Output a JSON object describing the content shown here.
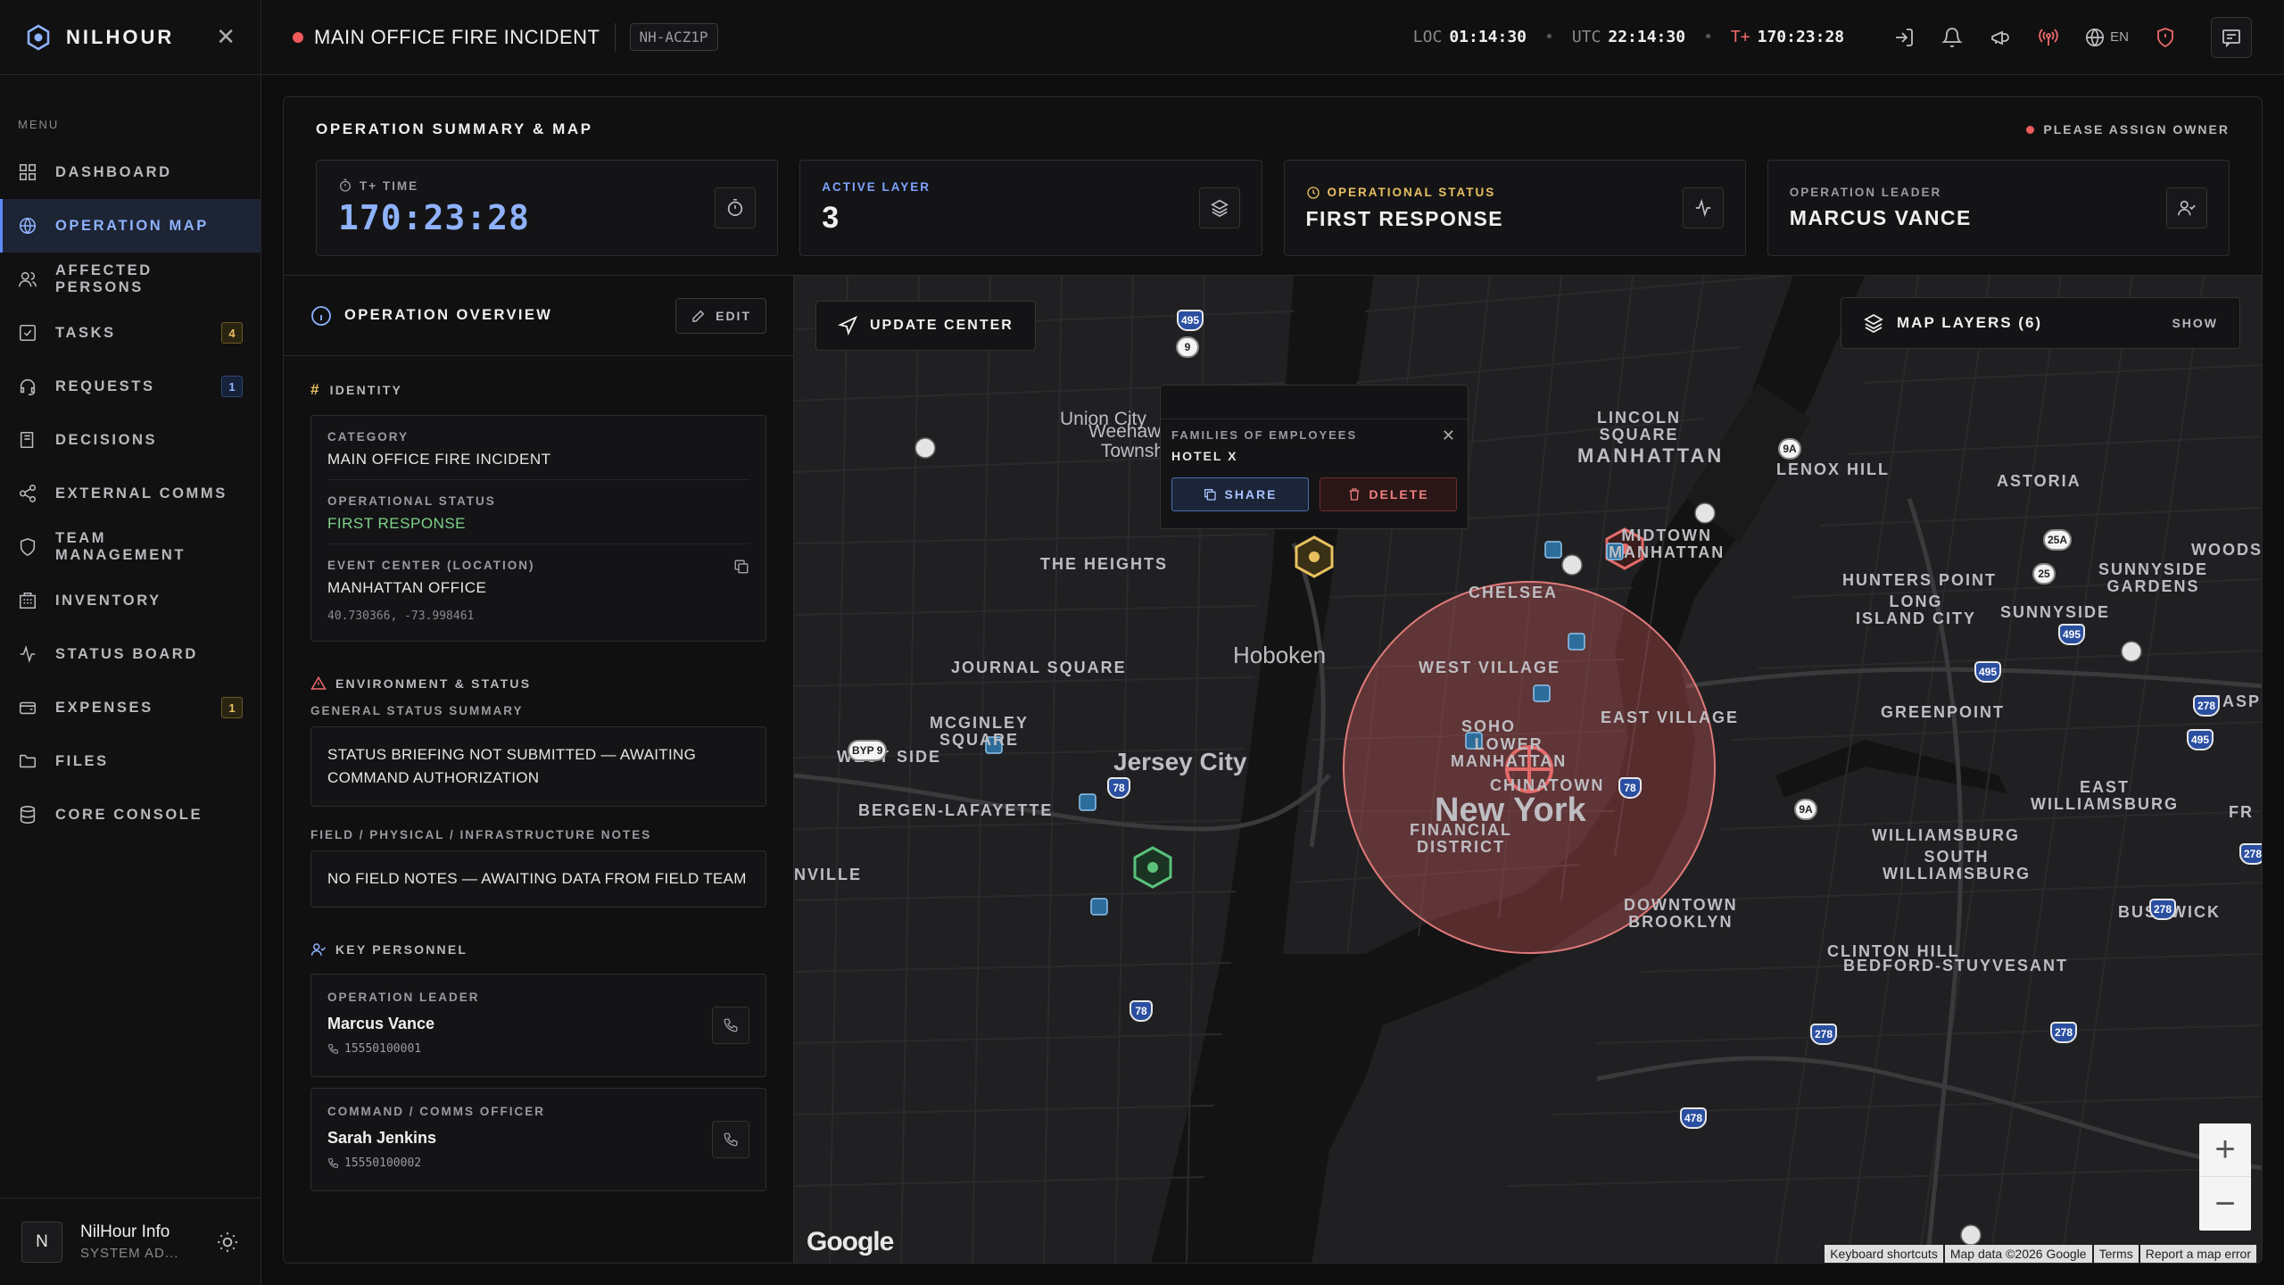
{
  "app": {
    "name": "NILHOUR"
  },
  "sidebar": {
    "menu_label": "MENU",
    "items": [
      {
        "label": "DASHBOARD",
        "icon": "grid-icon"
      },
      {
        "label": "OPERATION MAP",
        "icon": "globe-icon",
        "active": true
      },
      {
        "label": "AFFECTED PERSONS",
        "icon": "users-icon"
      },
      {
        "label": "TASKS",
        "icon": "checkbox-icon",
        "badge": "4"
      },
      {
        "label": "REQUESTS",
        "icon": "headset-icon",
        "badge": "1"
      },
      {
        "label": "DECISIONS",
        "icon": "book-icon"
      },
      {
        "label": "EXTERNAL COMMS",
        "icon": "share-icon"
      },
      {
        "label": "TEAM MANAGEMENT",
        "icon": "shield-icon"
      },
      {
        "label": "INVENTORY",
        "icon": "building-icon"
      },
      {
        "label": "STATUS BOARD",
        "icon": "activity-icon"
      },
      {
        "label": "EXPENSES",
        "icon": "wallet-icon",
        "badge": "1"
      },
      {
        "label": "FILES",
        "icon": "folder-icon"
      },
      {
        "label": "CORE CONSOLE",
        "icon": "database-icon"
      }
    ],
    "user": {
      "initial": "N",
      "name": "NilHour Info",
      "role": "SYSTEM AD..."
    }
  },
  "topbar": {
    "incident_title": "MAIN OFFICE FIRE INCIDENT",
    "incident_code": "NH-ACZ1P",
    "loc_label": "LOC",
    "loc_time": "01:14:30",
    "utc_label": "UTC",
    "utc_time": "22:14:30",
    "tplus_label": "T+",
    "tplus_time": "170:23:28",
    "lang": "EN"
  },
  "summary": {
    "title": "OPERATION SUMMARY & MAP",
    "assign": "PLEASE ASSIGN OWNER",
    "cards": {
      "time_label": "T+ TIME",
      "time_value": "170:23:28",
      "layer_label": "ACTIVE LAYER",
      "layer_value": "3",
      "status_label": "OPERATIONAL STATUS",
      "status_value": "FIRST RESPONSE",
      "leader_label": "OPERATION LEADER",
      "leader_value": "MARCUS VANCE"
    }
  },
  "overview": {
    "title": "OPERATION OVERVIEW",
    "edit": "EDIT",
    "identity_title": "IDENTITY",
    "category_label": "CATEGORY",
    "category_value": "MAIN OFFICE FIRE INCIDENT",
    "opstatus_label": "OPERATIONAL STATUS",
    "opstatus_value": "FIRST RESPONSE",
    "center_label": "EVENT CENTER (LOCATION)",
    "center_value": "MANHATTAN OFFICE",
    "center_coords": "40.730366, -73.998461",
    "env_title": "ENVIRONMENT & STATUS",
    "general_label": "GENERAL STATUS SUMMARY",
    "general_value": "STATUS BRIEFING NOT SUBMITTED — AWAITING COMMAND AUTHORIZATION",
    "field_label": "FIELD / PHYSICAL / INFRASTRUCTURE NOTES",
    "field_value": "NO FIELD NOTES — AWAITING DATA FROM FIELD TEAM",
    "personnel_title": "KEY PERSONNEL",
    "personnel": [
      {
        "role": "OPERATION LEADER",
        "name": "Marcus Vance",
        "phone": "15550100001"
      },
      {
        "role": "COMMAND / COMMS OFFICER",
        "name": "Sarah Jenkins",
        "phone": "15550100002"
      }
    ]
  },
  "map": {
    "update_center": "UPDATE CENTER",
    "layers_label": "MAP LAYERS (6)",
    "layers_show": "SHOW",
    "popup": {
      "label": "FAMILIES OF EMPLOYEES",
      "name": "HOTEL X",
      "share": "SHARE",
      "delete": "DELETE"
    },
    "google": "Google",
    "attribution": [
      "Keyboard shortcuts",
      "Map data ©2026 Google",
      "Terms",
      "Report a map error"
    ],
    "labels": {
      "union_city": "Union City",
      "weehawken": "Weehawken\nTownship",
      "manhattan": "MANHATTAN",
      "lincoln_sq": "LINCOLN\nSQUARE",
      "lenox_hill": "LENOX HILL",
      "astoria": "ASTORIA",
      "midtown": "MIDTOWN\nMANHATTAN",
      "heights": "THE HEIGHTS",
      "chelsea": "CHELSEA",
      "hunters_point": "HUNTERS POINT",
      "lic": "LONG\nISLAND CITY",
      "sunnyside": "SUNNYSIDE",
      "sunnyside_gardens": "SUNNYSIDE\nGARDENS",
      "woods": "WOODSI",
      "hoboken": "Hoboken",
      "journal_sq": "JOURNAL SQUARE",
      "west_village": "WEST VILLAGE",
      "greenpoint": "GREENPOINT",
      "east_village": "EAST VILLAGE",
      "soho": "SOHO",
      "lower_manhattan": "LOWER\nMANHATTAN",
      "mcginley": "MCGINLEY\nSQUARE",
      "west_side": "WEST SIDE",
      "jersey_city": "Jersey City",
      "chinatown": "CHINATOWN",
      "new_york": "New York",
      "bergen": "BERGEN-LAFAYETTE",
      "financial": "FINANCIAL\nDISTRICT",
      "east_williamsburg": "EAST\nWILLIAMSBURG",
      "williamsburg": "WILLIAMSBURG",
      "south_williamsburg": "SOUTH\nWILLIAMSBURG",
      "downtown_brooklyn": "DOWNTOWN\nBROOKLYN",
      "clinton_hill": "CLINTON HILL",
      "bedford": "BEDFORD-STUYVESANT",
      "bushwick": "BUSHWICK",
      "maspe": "MASPE",
      "nville": "NVILLE",
      "fr": "FR"
    },
    "shields": [
      "495",
      "9",
      "9A",
      "25A",
      "25",
      "495",
      "495",
      "278",
      "495",
      "BYP 9",
      "78",
      "78",
      "9A",
      "278",
      "278",
      "278",
      "278",
      "78",
      "478"
    ]
  }
}
